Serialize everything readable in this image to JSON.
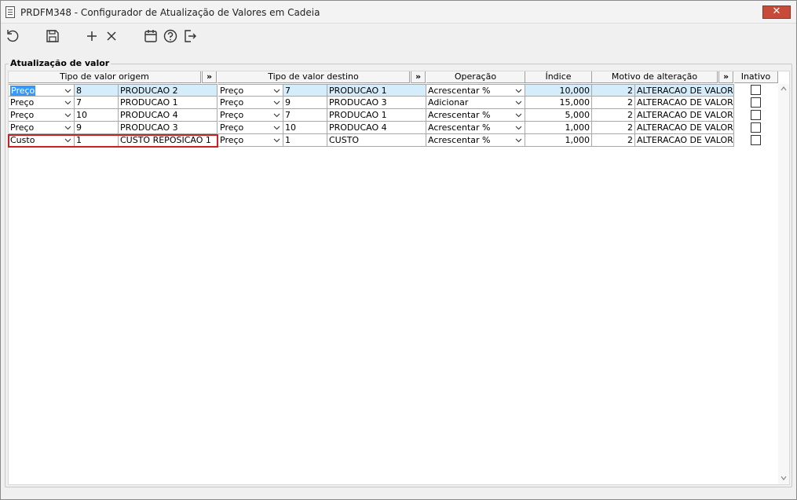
{
  "window": {
    "title": "PRDFM348 - Configurador de Atualização de Valores em Cadeia",
    "close_label": "✕"
  },
  "toolbar": {
    "icons": [
      "refresh-icon",
      "save-icon",
      "plus-icon",
      "x-icon",
      "calendar-icon",
      "help-icon",
      "exit-icon"
    ]
  },
  "group": {
    "label": "Atualização de valor"
  },
  "columns": {
    "origem": "Tipo de valor origem",
    "destino": "Tipo de valor destino",
    "operacao": "Operação",
    "indice": "Índice",
    "motivo": "Motivo de alteração",
    "inativo": "Inativo",
    "expand": "»"
  },
  "rows": [
    {
      "tipo_origem": "Preço",
      "cod_origem": "8",
      "desc_origem": "PRODUCAO 2",
      "tipo_destino": "Preço",
      "cod_destino": "7",
      "desc_destino": "PRODUCAO 1",
      "operacao": "Acrescentar %",
      "indice": "10,000",
      "motivo_cod": "2",
      "motivo_desc": "ALTERACAO DE VALOR",
      "inativo": false
    },
    {
      "tipo_origem": "Preço",
      "cod_origem": "7",
      "desc_origem": "PRODUCAO 1",
      "tipo_destino": "Preço",
      "cod_destino": "9",
      "desc_destino": "PRODUCAO 3",
      "operacao": "Adicionar",
      "indice": "15,000",
      "motivo_cod": "2",
      "motivo_desc": "ALTERACAO DE VALOR",
      "inativo": false
    },
    {
      "tipo_origem": "Preço",
      "cod_origem": "10",
      "desc_origem": "PRODUCAO 4",
      "tipo_destino": "Preço",
      "cod_destino": "7",
      "desc_destino": "PRODUCAO 1",
      "operacao": "Acrescentar %",
      "indice": "5,000",
      "motivo_cod": "2",
      "motivo_desc": "ALTERACAO DE VALOR",
      "inativo": false
    },
    {
      "tipo_origem": "Preço",
      "cod_origem": "9",
      "desc_origem": "PRODUCAO 3",
      "tipo_destino": "Preço",
      "cod_destino": "10",
      "desc_destino": "PRODUCAO 4",
      "operacao": "Acrescentar %",
      "indice": "1,000",
      "motivo_cod": "2",
      "motivo_desc": "ALTERACAO DE VALOR",
      "inativo": false
    },
    {
      "tipo_origem": "Custo",
      "cod_origem": "1",
      "desc_origem": "CUSTO REPOSICAO 1",
      "tipo_destino": "Preço",
      "cod_destino": "1",
      "desc_destino": "CUSTO",
      "operacao": "Acrescentar %",
      "indice": "1,000",
      "motivo_cod": "2",
      "motivo_desc": "ALTERACAO DE VALOR",
      "inativo": false
    }
  ],
  "colors": {
    "selected_row": "#d5ecfa",
    "text_highlight": "#3399ff",
    "focus_border": "#cc1f1f",
    "close_button": "#c74b38"
  }
}
